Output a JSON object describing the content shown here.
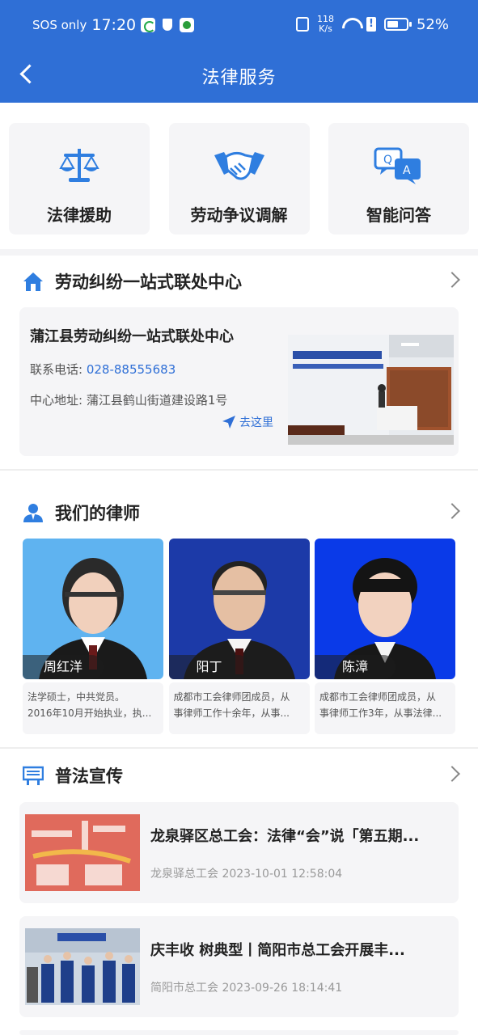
{
  "status_bar": {
    "carrier": "SOS only",
    "time": "17:20",
    "net_speed_value": "118",
    "net_speed_unit": "K/s",
    "battery": "52%"
  },
  "header": {
    "title": "法律服务"
  },
  "services": [
    {
      "label": "法律援助",
      "icon": "scales-icon"
    },
    {
      "label": "劳动争议调解",
      "icon": "handshake-icon"
    },
    {
      "label": "智能问答",
      "icon": "qa-chat-icon"
    }
  ],
  "center_section": {
    "title": "劳动纠纷一站式联处中心",
    "card": {
      "name": "蒲江县劳动纠纷一站式联处中心",
      "phone_label": "联系电话:",
      "phone": "028-88555683",
      "address_label": "中心地址:",
      "address": "蒲江县鹤山街道建设路1号",
      "go_label": "去这里"
    }
  },
  "lawyers_section": {
    "title": "我们的律师",
    "lawyers": [
      {
        "name": "周红洋",
        "desc_line1": "法学硕士，中共党员。",
        "desc_line2": "2016年10月开始执业，执..."
      },
      {
        "name": "阳丁",
        "desc_line1": "成都市工会律师团成员，从",
        "desc_line2": "事律师工作十余年，从事..."
      },
      {
        "name": "陈漳",
        "desc_line1": "成都市工会律师团成员，从",
        "desc_line2": "事律师工作3年，从事法律..."
      }
    ]
  },
  "publicity_section": {
    "title": "普法宣传",
    "articles": [
      {
        "title": "龙泉驿区总工会：法律“会”说「第五期...",
        "source": "龙泉驿总工会",
        "datetime": "2023-10-01 12:58:04"
      },
      {
        "title": "庆丰收 树典型丨简阳市总工会开展丰...",
        "source": "简阳市总工会",
        "datetime": "2023-09-26 18:14:41"
      }
    ]
  },
  "colors": {
    "primary": "#2f6fd6",
    "card_bg": "#f5f5f7"
  }
}
